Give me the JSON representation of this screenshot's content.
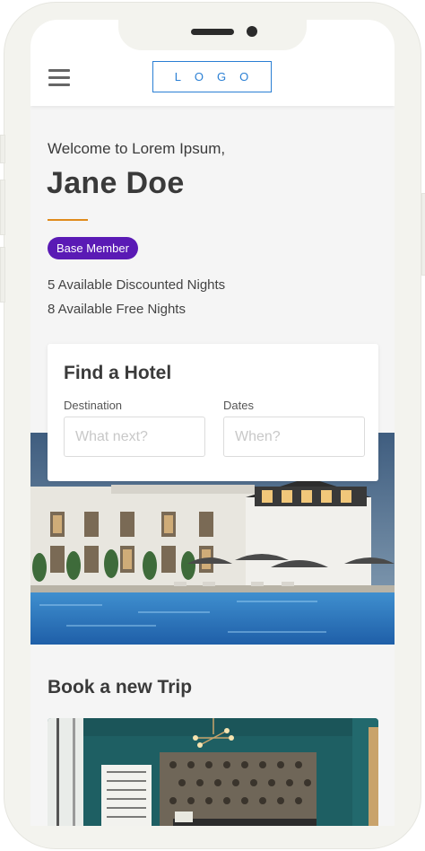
{
  "header": {
    "logo_text": "LOGO",
    "menu_icon": "hamburger-menu-icon"
  },
  "welcome": {
    "greeting": "Welcome to Lorem Ipsum,",
    "name": "Jane Doe",
    "membership": "Base Member",
    "stats": [
      "5 Available Discounted Nights",
      "8 Available Free Nights"
    ]
  },
  "search": {
    "title": "Find a Hotel",
    "destination_label": "Destination",
    "destination_placeholder": "What next?",
    "destination_value": "",
    "dates_label": "Dates",
    "dates_placeholder": "When?",
    "dates_value": ""
  },
  "trips": {
    "title": "Book a new Trip"
  },
  "colors": {
    "accent": "#e08b1c",
    "badge": "#5a1ab5",
    "logo": "#2a7fd4"
  }
}
